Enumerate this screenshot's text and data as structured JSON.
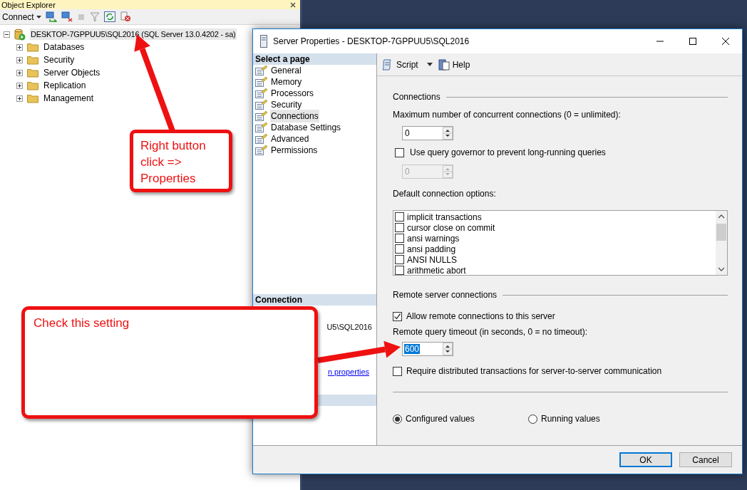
{
  "object_explorer": {
    "title": "Object Explorer",
    "connect": "Connect",
    "tree": [
      {
        "label": "DESKTOP-7GPPUU5\\SQL2016 (SQL Server 13.0.4202 - sa)",
        "expanded": true,
        "selected": true,
        "children": [
          {
            "label": "Databases",
            "expanded": false,
            "selected": false
          },
          {
            "label": "Security",
            "expanded": false,
            "selected": false
          },
          {
            "label": "Server Objects",
            "expanded": false,
            "selected": false
          },
          {
            "label": "Replication",
            "expanded": false,
            "selected": false
          },
          {
            "label": "Management",
            "expanded": false,
            "selected": false
          }
        ]
      }
    ]
  },
  "dialog": {
    "title": "Server Properties - DESKTOP-7GPPUU5\\SQL2016",
    "select_page_header": "Select a page",
    "pages": [
      {
        "label": "General",
        "selected": false
      },
      {
        "label": "Memory",
        "selected": false
      },
      {
        "label": "Processors",
        "selected": false
      },
      {
        "label": "Security",
        "selected": false
      },
      {
        "label": "Connections",
        "selected": true
      },
      {
        "label": "Database Settings",
        "selected": false
      },
      {
        "label": "Advanced",
        "selected": false
      },
      {
        "label": "Permissions",
        "selected": false
      }
    ],
    "connection_header": "Connection",
    "connection_text": "U5\\SQL2016",
    "connection_link": "n properties",
    "toolbar": {
      "script": "Script",
      "help": "Help"
    },
    "connections_group": "Connections",
    "max_connections_label": "Maximum number of concurrent connections (0 = unlimited):",
    "max_connections_value": "0",
    "query_governor": {
      "label": "Use query governor to prevent long-running queries",
      "checked": false
    },
    "governor_value": {
      "value": "0",
      "disabled": true
    },
    "default_options_label": "Default connection options:",
    "options": [
      {
        "label": "implicit transactions",
        "checked": false
      },
      {
        "label": "cursor close on commit",
        "checked": false
      },
      {
        "label": "ansi warnings",
        "checked": false
      },
      {
        "label": "ansi padding",
        "checked": false
      },
      {
        "label": "ANSI NULLS",
        "checked": false
      },
      {
        "label": "arithmetic abort",
        "checked": false
      }
    ],
    "remote_group": "Remote server connections",
    "allow_remote": {
      "label": "Allow remote connections to this server",
      "checked": true
    },
    "timeout_label": "Remote query timeout (in seconds, 0 = no timeout):",
    "timeout_value": {
      "value": "600",
      "selected": true
    },
    "require_distributed": {
      "label": "Require distributed transactions for server-to-server communication",
      "checked": false
    },
    "radios": [
      {
        "label": "Configured values",
        "selected": true
      },
      {
        "label": "Running values",
        "selected": false
      }
    ],
    "buttons": [
      {
        "label": "OK",
        "default": true
      },
      {
        "label": "Cancel",
        "default": false
      }
    ]
  },
  "annotations": [
    {
      "text": "Right button click => Properties"
    },
    {
      "text": "Check this setting"
    }
  ]
}
